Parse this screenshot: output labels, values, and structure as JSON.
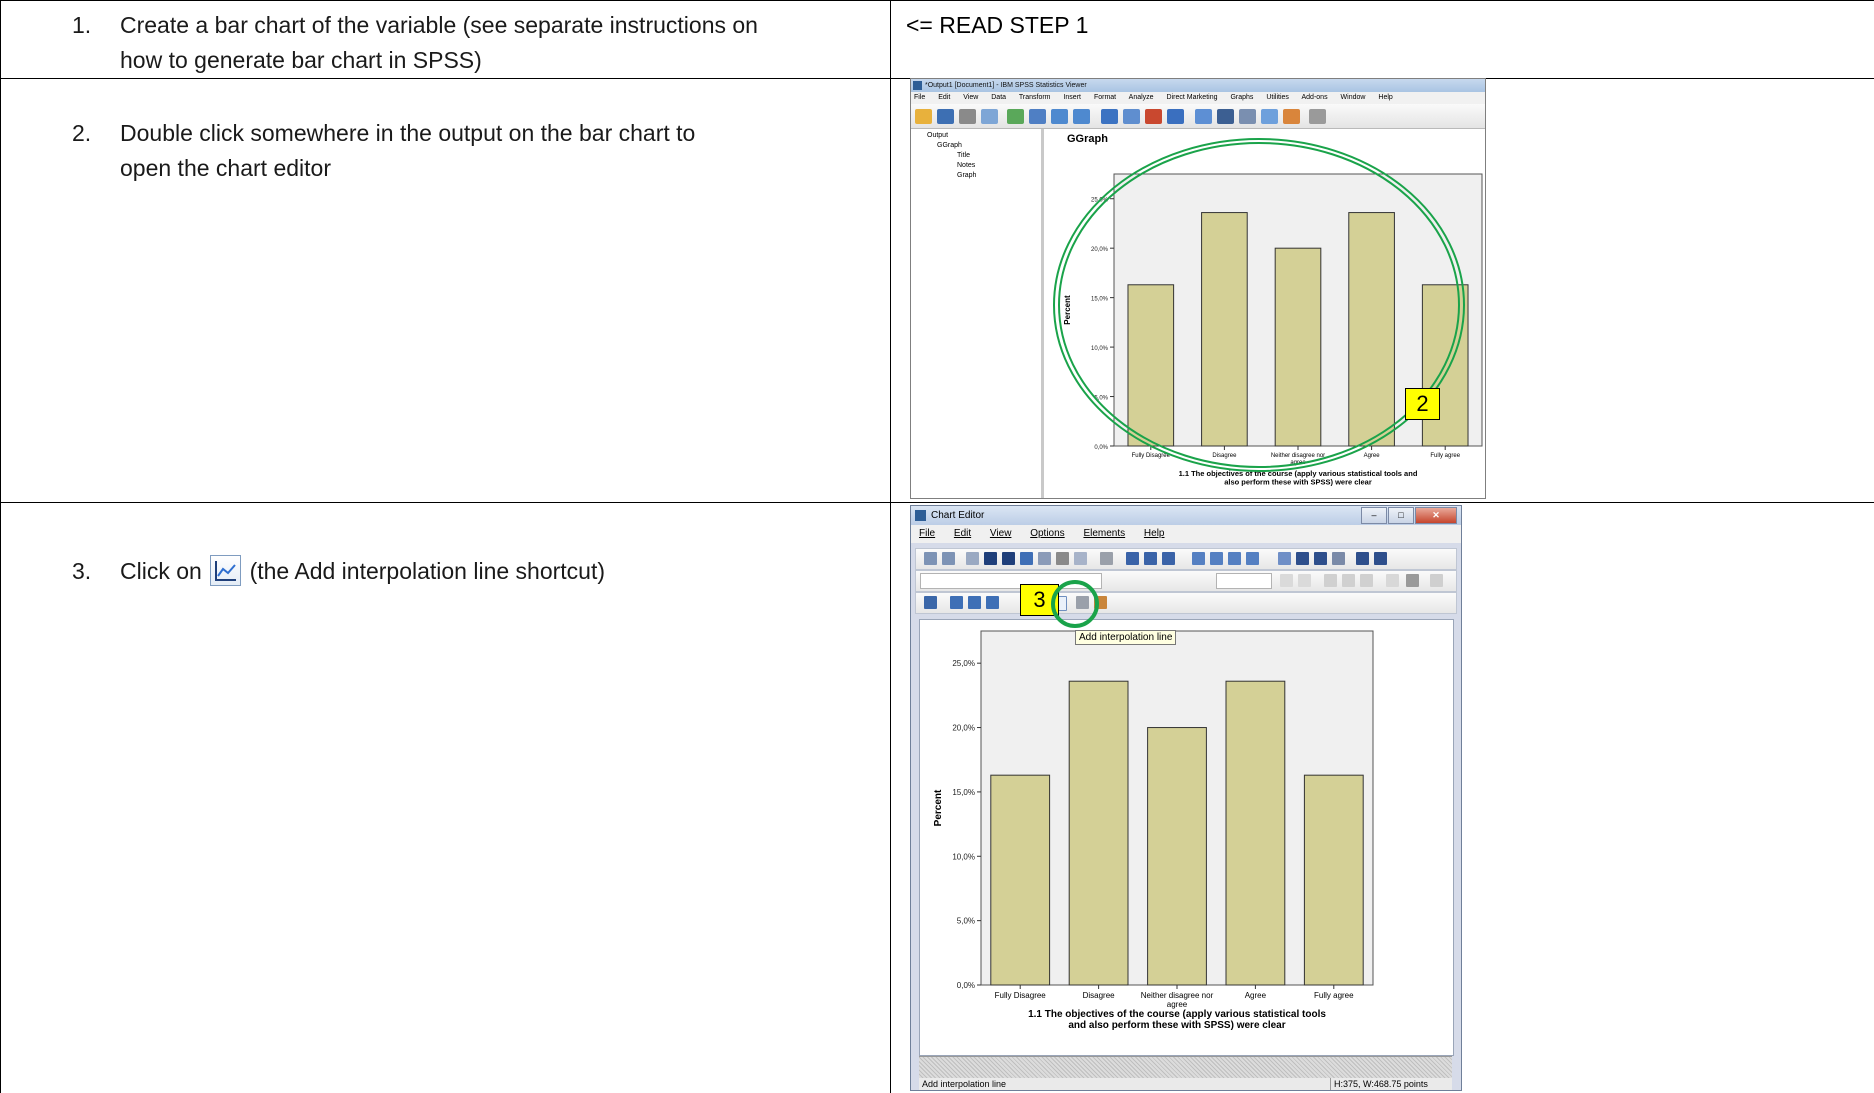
{
  "steps": {
    "s1": {
      "num": "1.",
      "line1": "Create a bar chart of the variable (see separate instructions on",
      "line2": "how to generate bar chart in SPSS)"
    },
    "s1_side": "<= READ STEP 1",
    "s2": {
      "num": "2.",
      "line1": "Double click somewhere in the output on the bar chart  to",
      "line2": "open the chart editor"
    },
    "s3": {
      "num": "3.",
      "before": "Click on",
      "after": "(the Add interpolation line shortcut)",
      "icon": "interpolation-line-icon"
    }
  },
  "viewer": {
    "title": "*Output1 [Document1] - IBM SPSS Statistics Viewer",
    "menu": [
      "File",
      "Edit",
      "View",
      "Data",
      "Transform",
      "Insert",
      "Format",
      "Analyze",
      "Direct Marketing",
      "Graphs",
      "Utilities",
      "Add-ons",
      "Window",
      "Help"
    ],
    "tree": [
      "Output",
      "GGraph",
      "Title",
      "Notes",
      "Graph"
    ],
    "heading": "GGraph",
    "badge": "2"
  },
  "editor": {
    "title": "Chart Editor",
    "menu": [
      "File",
      "Edit",
      "View",
      "Options",
      "Elements",
      "Help"
    ],
    "tooltip": "Add interpolation line",
    "badge": "3",
    "status_left": "Add interpolation line",
    "status_right": "H:375, W:468.75 points"
  },
  "colors": {
    "bar": "#d4d096",
    "bar_stroke": "#333333",
    "plot_bg": "#f0f0f0",
    "ellipse": "#1aa34a",
    "badge": "#ffff00"
  },
  "chart_data": [
    {
      "type": "bar",
      "categories": [
        "Fully Disagree",
        "Disagree",
        "Neither disagree nor agree",
        "Agree",
        "Fully agree"
      ],
      "values": [
        16.3,
        23.6,
        20.0,
        23.6,
        16.3
      ],
      "ylabel": "Percent",
      "xlabel": "1.1 The objectives of the course (apply various statistical tools and also perform these with SPSS) were clear",
      "yticks": [
        "0,0%",
        "5,0%",
        "10,0%",
        "15,0%",
        "20,0%",
        "25,0%"
      ],
      "ylim": [
        0,
        27.5
      ]
    },
    {
      "type": "bar",
      "categories": [
        "Fully Disagree",
        "Disagree",
        "Neither disagree nor agree",
        "Agree",
        "Fully agree"
      ],
      "values": [
        16.3,
        23.6,
        20.0,
        23.6,
        16.3
      ],
      "ylabel": "Percent",
      "xlabel": "1.1 The objectives of the course (apply various statistical tools and also perform these with SPSS) were clear",
      "yticks": [
        "0,0%",
        "5,0%",
        "10,0%",
        "15,0%",
        "20,0%",
        "25,0%"
      ],
      "ylim": [
        0,
        27.5
      ]
    }
  ]
}
